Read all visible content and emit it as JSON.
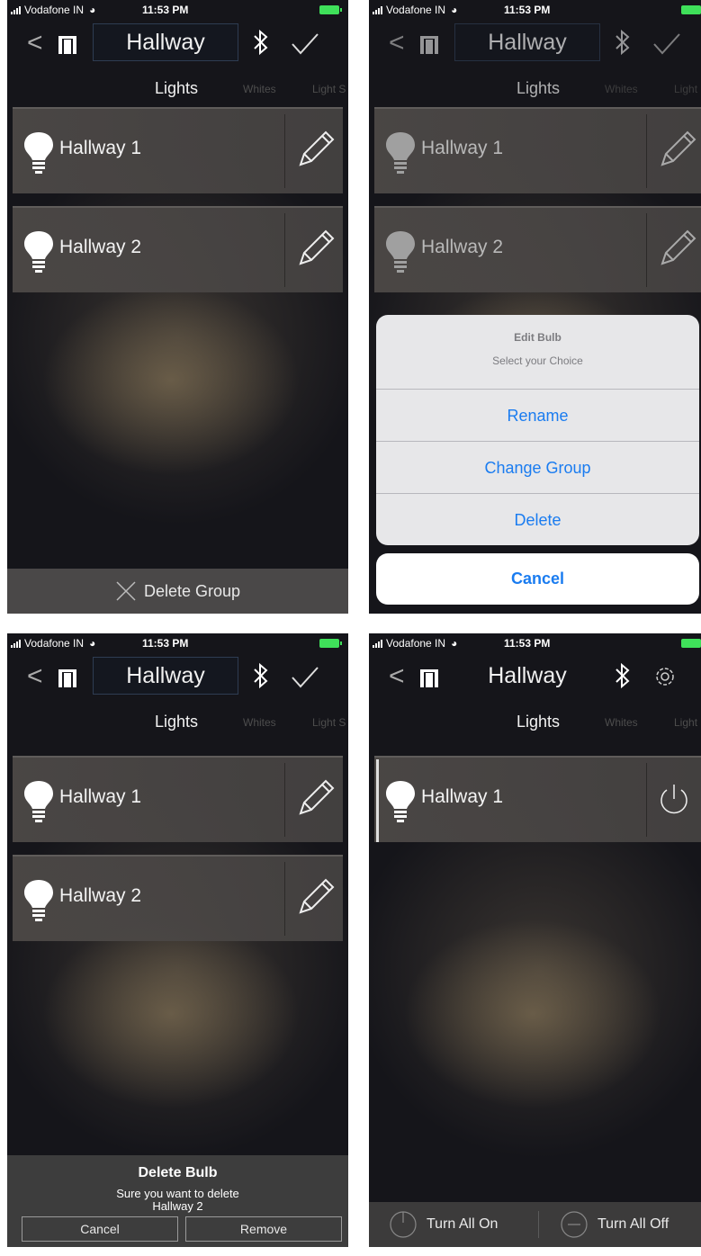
{
  "status": {
    "carrier": "Vodafone IN",
    "time": "11:53 PM"
  },
  "nav": {
    "title": "Hallway",
    "back_glyph": "<"
  },
  "tabs": {
    "lights": "Lights",
    "whites": "Whites",
    "third": "Light S"
  },
  "bulbs": [
    "Hallway 1",
    "Hallway 2"
  ],
  "screen1": {
    "delete_group": "Delete Group"
  },
  "screen2": {
    "sheet_title": "Edit Bulb",
    "sheet_subtitle": "Select your Choice",
    "options": [
      "Rename",
      "Change Group",
      "Delete"
    ],
    "cancel": "Cancel"
  },
  "screen3": {
    "title": "Delete Bulb",
    "message_line1": "Sure you want to delete",
    "message_line2": "Hallway 2",
    "cancel": "Cancel",
    "remove": "Remove"
  },
  "screen4": {
    "turn_all_on": "Turn All On",
    "turn_all_off": "Turn All Off"
  },
  "colors": {
    "accent_blue": "#1a7cf0",
    "battery_green": "#3fe05a"
  },
  "icons": [
    "back-icon",
    "door-icon",
    "bluetooth-icon",
    "check-icon",
    "gear-icon",
    "bulb-icon",
    "pencil-icon",
    "power-icon",
    "close-icon",
    "minus-icon"
  ]
}
